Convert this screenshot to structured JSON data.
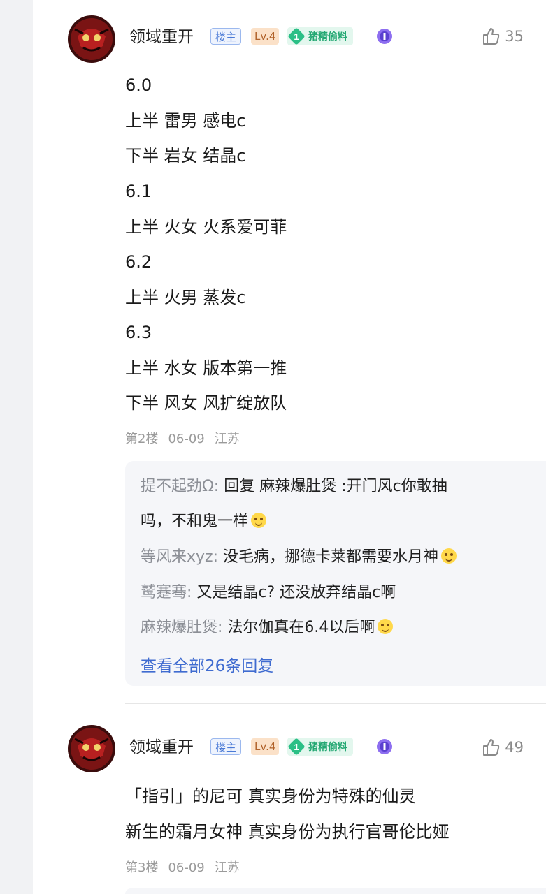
{
  "posts": [
    {
      "username": "领域重开",
      "owner_badge": "楼主",
      "level": "Lv.4",
      "fan_level": "1",
      "fan_badge": "猪精偷料",
      "likes": "35",
      "lines": [
        "6.0",
        "上半 雷男 感电c",
        "下半 岩女 结晶c",
        "6.1",
        "上半 火女 火系爱可菲",
        "6.2",
        "上半 火男 蒸发c",
        "6.3",
        "上半 水女 版本第一推",
        "下半 风女 风扩绽放队"
      ],
      "floor": "第2楼",
      "date": "06-09",
      "location": "江苏",
      "replies": [
        {
          "author": "提不起劲Ω:",
          "text": " 回复 麻辣爆肚煲 :开门风c你敢抽",
          "text2": "吗，不和鬼一样",
          "emoji": "smile"
        },
        {
          "author": "等风来xyz:",
          "text": " 没毛病，挪德卡莱都需要水月神",
          "emoji": "laugh"
        },
        {
          "author": "鹫蹇骞:",
          "text": " 又是结晶c? 还没放弃结晶c啊"
        },
        {
          "author": "麻辣爆肚煲:",
          "text": " 法尔伽真在6.4以后啊",
          "emoji": "sneer"
        }
      ],
      "see_all": "查看全部26条回复"
    },
    {
      "username": "领域重开",
      "owner_badge": "楼主",
      "level": "Lv.4",
      "fan_level": "1",
      "fan_badge": "猪精偷料",
      "likes": "49",
      "lines": [
        "「指引」的尼可 真实身份为特殊的仙灵",
        "新生的霜月女神 真实身份为执行官哥伦比娅"
      ],
      "floor": "第3楼",
      "date": "06-09",
      "location": "江苏"
    }
  ],
  "colors": {
    "accent_link": "#3f6bd0",
    "owner_badge": "#4a7ad6",
    "fan_badge": "#2bbf86",
    "level_badge": "#fbe1c8"
  }
}
